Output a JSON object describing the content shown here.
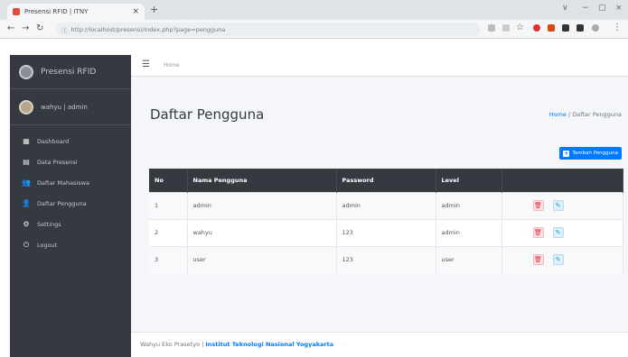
{
  "browser": {
    "tab_title": "Presensi RFID | ITNY",
    "tab_close": "×",
    "new_tab": "+",
    "url": "http://localhost/presensi/index.php?page=pengguna",
    "window_controls": [
      "∨",
      "−",
      "▢",
      "×"
    ]
  },
  "sidebar": {
    "brand": "Presensi RFID",
    "user": "wahyu | admin",
    "items": [
      {
        "label": "Dashboard",
        "icon": "table-icon",
        "glyph": "▦"
      },
      {
        "label": "Data Presensi",
        "icon": "calendar-icon",
        "glyph": "▤"
      },
      {
        "label": "Daftar Mahasiswa",
        "icon": "users-icon",
        "glyph": "👥"
      },
      {
        "label": "Daftar Pengguna",
        "icon": "user-icon",
        "glyph": "👤"
      },
      {
        "label": "Settings",
        "icon": "gear-icon",
        "glyph": "⚙"
      },
      {
        "label": "Logout",
        "icon": "power-icon",
        "glyph": "⏻"
      }
    ]
  },
  "header": {
    "menu_glyph": "☰",
    "home": "Home"
  },
  "main": {
    "title": "Daftar Pengguna",
    "breadcrumb": {
      "home": "Home",
      "separator": "/",
      "current": "Daftar Pengguna"
    },
    "add_button": "Tambah Pengguna",
    "table": {
      "columns": [
        "No",
        "Nama Pengguna",
        "Password",
        "Level",
        ""
      ],
      "rows": [
        {
          "no": "1",
          "nama": "admin",
          "password": "admin",
          "level": "admin"
        },
        {
          "no": "2",
          "nama": "wahyu",
          "password": "123",
          "level": "admin"
        },
        {
          "no": "3",
          "nama": "user",
          "password": "123",
          "level": "user"
        }
      ]
    }
  },
  "footer": {
    "author": "Wahyu Eko Prasetyo | ",
    "org": "Institut Teknologi Nasional Yogyakarta"
  },
  "colors": {
    "sidebar": "#343a40",
    "primary": "#007bff",
    "danger": "#dc3545",
    "info": "#17a2b8"
  }
}
